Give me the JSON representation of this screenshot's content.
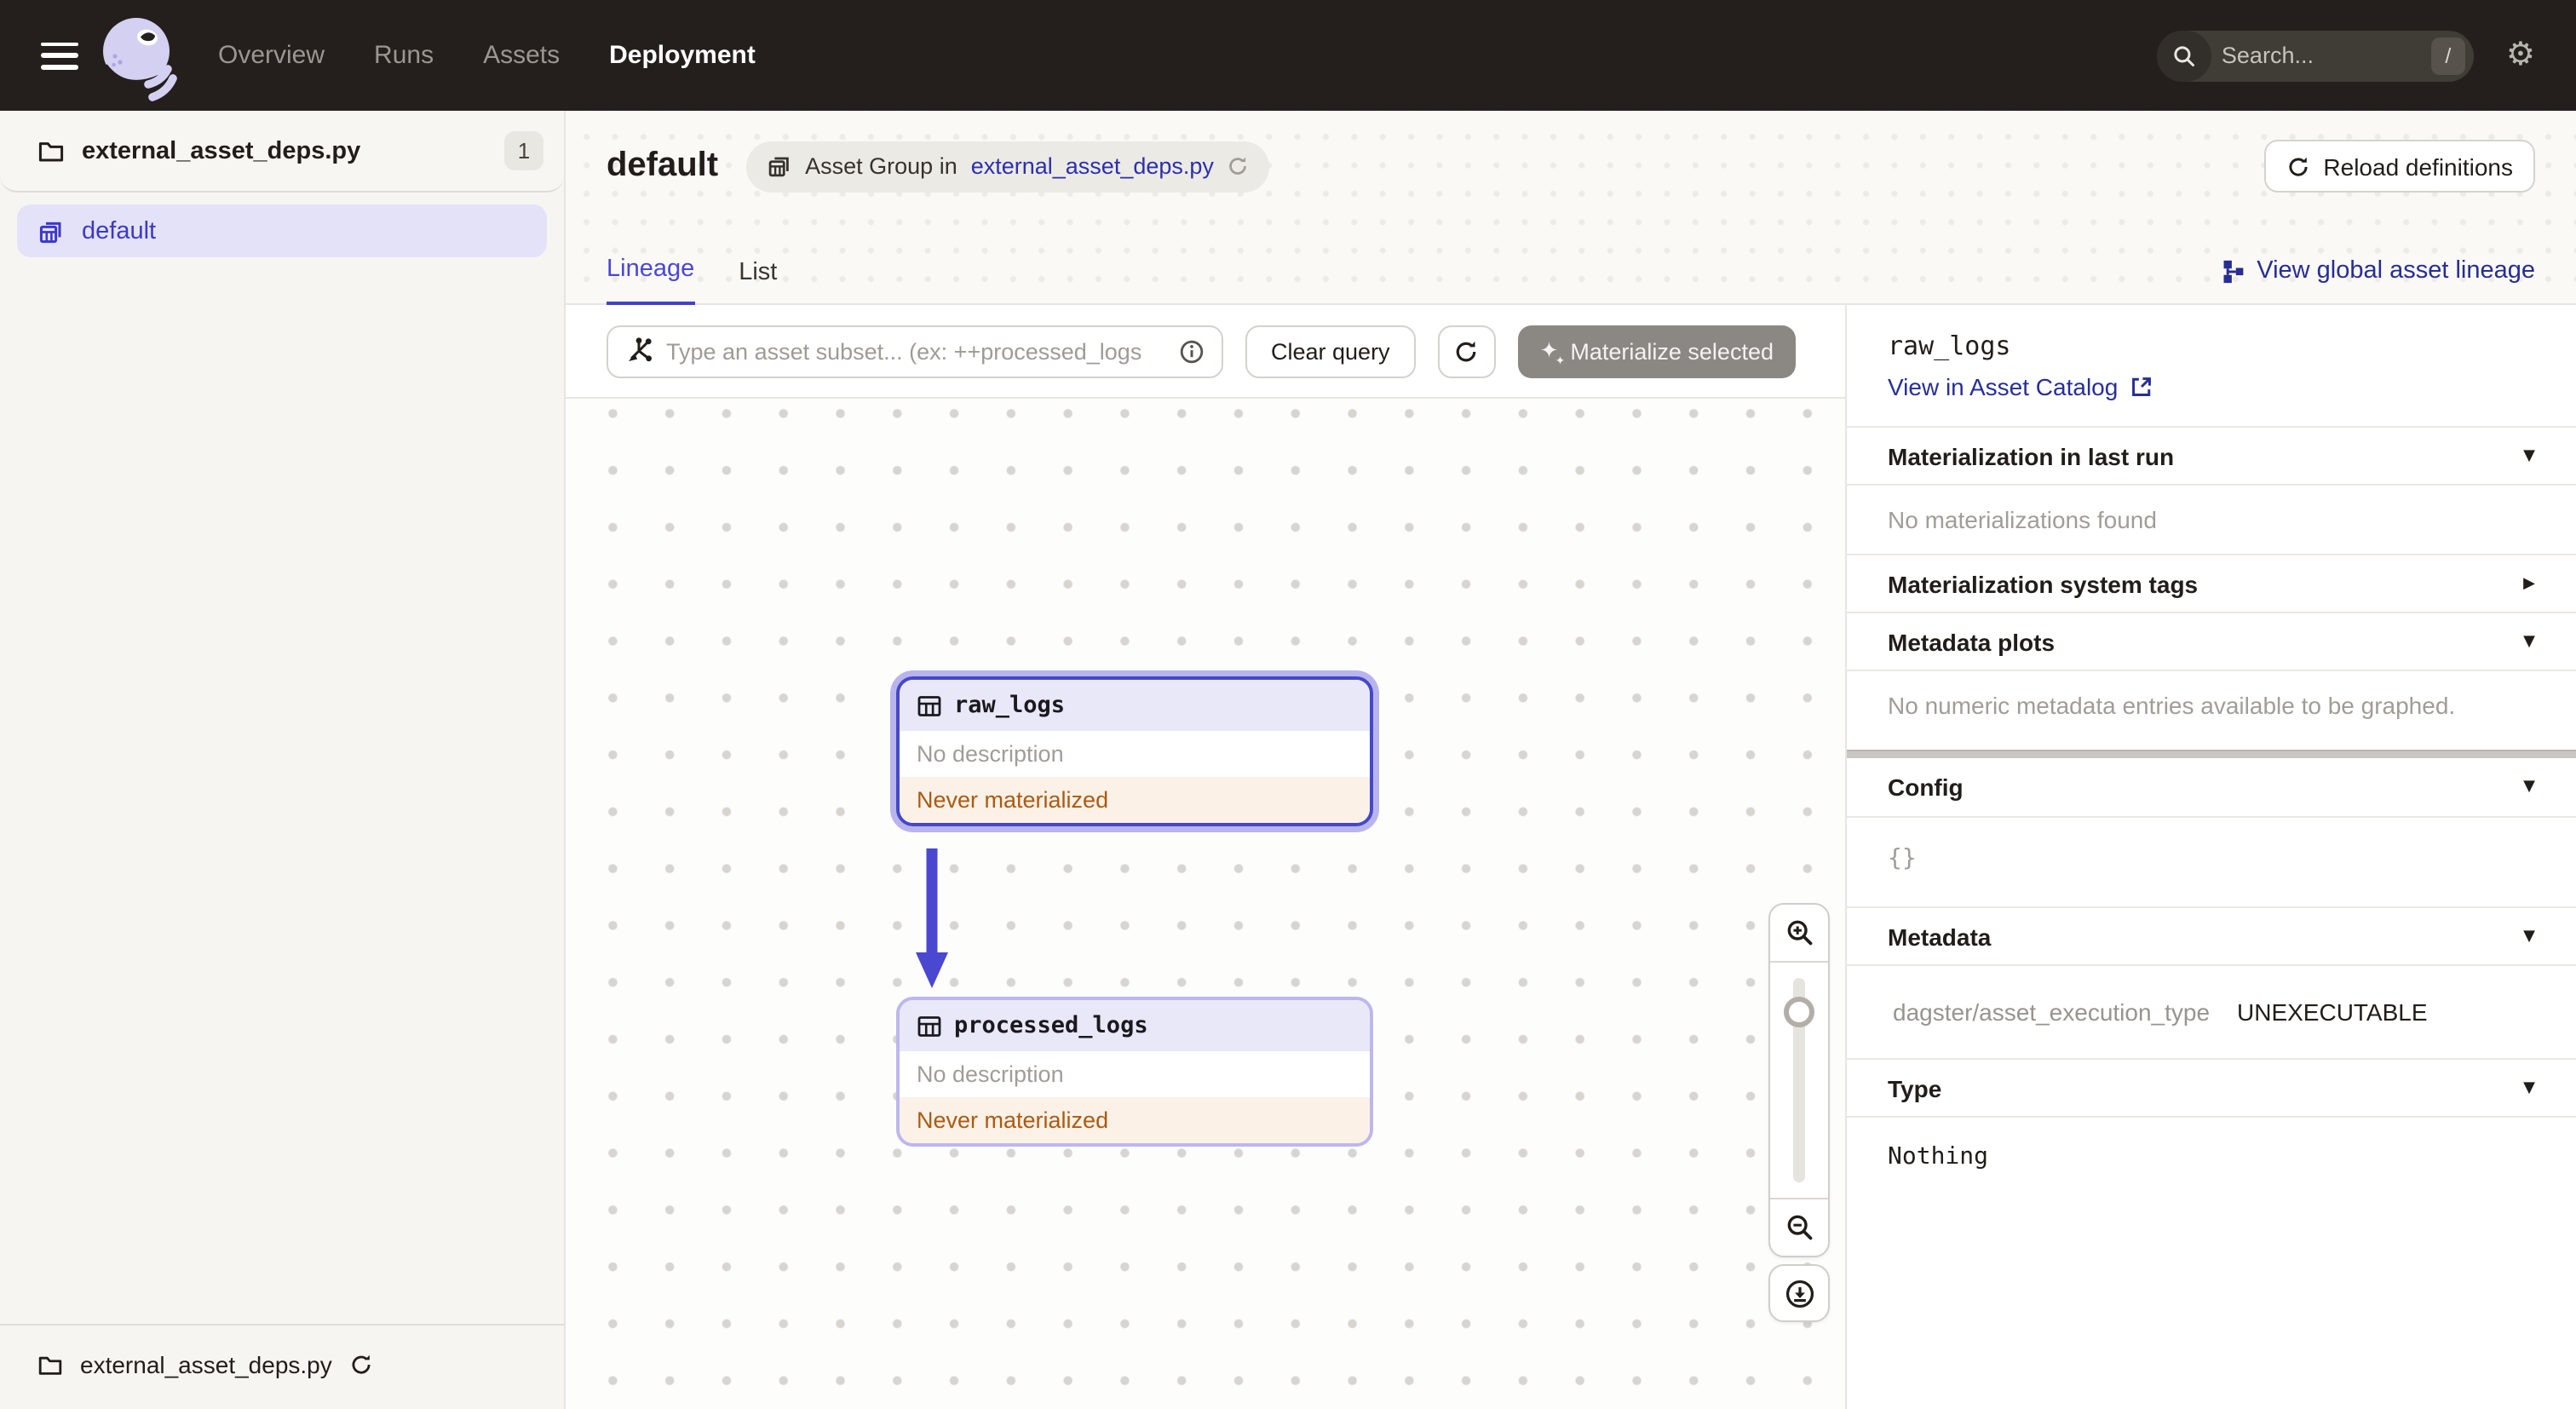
{
  "navbar": {
    "items": [
      {
        "label": "Overview",
        "active": false
      },
      {
        "label": "Runs",
        "active": false
      },
      {
        "label": "Assets",
        "active": false
      },
      {
        "label": "Deployment",
        "active": true
      }
    ],
    "search": {
      "placeholder": "Search...",
      "shortcut": "/"
    }
  },
  "sidebar": {
    "file_header": {
      "label": "external_asset_deps.py",
      "count": "1"
    },
    "groups": [
      {
        "label": "default",
        "selected": true
      }
    ],
    "footer": {
      "label": "external_asset_deps.py"
    }
  },
  "header": {
    "title": "default",
    "chip": {
      "prefix": "Asset Group in",
      "link": "external_asset_deps.py"
    },
    "reload_button": "Reload definitions"
  },
  "tabs": [
    {
      "label": "Lineage",
      "active": true
    },
    {
      "label": "List",
      "active": false
    }
  ],
  "global_lineage_link": "View global asset lineage",
  "toolbar": {
    "query_placeholder": "Type an asset subset... (ex: ++processed_logs",
    "clear_button": "Clear query",
    "materialize_button": "Materialize selected"
  },
  "graph": {
    "nodes": [
      {
        "name": "raw_logs",
        "description": "No description",
        "status": "Never materialized",
        "selected": true
      },
      {
        "name": "processed_logs",
        "description": "No description",
        "status": "Never materialized",
        "selected": false
      }
    ]
  },
  "panel": {
    "title": "raw_logs",
    "catalog_link": "View in Asset Catalog",
    "sections": {
      "mat_last_run": {
        "label": "Materialization in last run",
        "body": "No materializations found",
        "expanded": true
      },
      "sys_tags": {
        "label": "Materialization system tags",
        "expanded": false
      },
      "metadata_plots": {
        "label": "Metadata plots",
        "body": "No numeric metadata entries available to be graphed.",
        "expanded": true
      },
      "config": {
        "label": "Config",
        "body": "{}",
        "expanded": true
      },
      "metadata": {
        "label": "Metadata",
        "key": "dagster/asset_execution_type",
        "value": "UNEXECUTABLE",
        "expanded": true
      },
      "type": {
        "label": "Type",
        "body": "Nothing",
        "expanded": true
      }
    }
  },
  "colors": {
    "accent_purple": "#4f43dd",
    "selection_halo": "#b9b4ed",
    "node_header_bg": "#e9e8f8",
    "status_orange_text": "#ac5a11",
    "status_orange_bg": "#fbf1e7",
    "link_navy": "#262d93",
    "navbar_bg": "#241f1c"
  }
}
